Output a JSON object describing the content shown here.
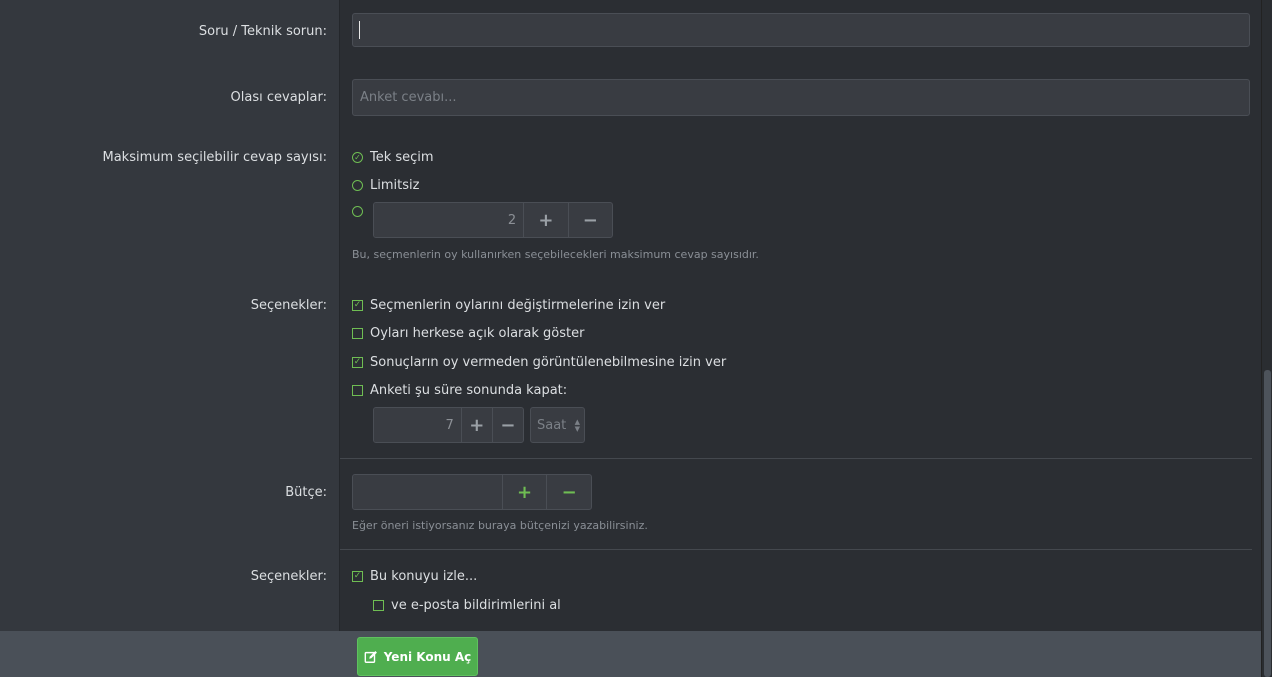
{
  "form": {
    "question_label": "Soru / Teknik sorun:",
    "question_value": "",
    "answers_label": "Olası cevaplar:",
    "answers_placeholder": "Anket cevabı...",
    "max_answers_label": "Maksimum seçilebilir cevap sayısı:",
    "max_answers_options": [
      {
        "label": "Tek seçim",
        "selected": true
      },
      {
        "label": "Limitsiz",
        "selected": false
      },
      {
        "label": "",
        "selected": false
      }
    ],
    "max_answers_value": "2",
    "max_answers_hint": "Bu, seçmenlerin oy kullanırken seçebilecekleri maksimum cevap sayısıdır.",
    "options_label": "Seçenekler:",
    "options": [
      {
        "label": "Seçmenlerin oylarını değiştirmelerine izin ver",
        "checked": true
      },
      {
        "label": "Oyları herkese açık olarak göster",
        "checked": false
      },
      {
        "label": "Sonuçların oy vermeden görüntülenebilmesine izin ver",
        "checked": true
      },
      {
        "label": "Anketi şu süre sonunda kapat:",
        "checked": false
      }
    ],
    "close_after_value": "7",
    "close_after_unit": "Saat",
    "budget_label": "Bütçe:",
    "budget_value": "",
    "budget_hint": "Eğer öneri istiyorsanız buraya bütçenizi yazabilirsiniz.",
    "watch_label": "Seçenekler:",
    "watch_options": [
      {
        "label": "Bu konuyu izle...",
        "checked": true
      },
      {
        "label": "ve e-posta bildirimlerini al",
        "checked": false
      }
    ],
    "submit_label": "Yeni Konu Aç"
  },
  "icons": {
    "plus": "+",
    "minus": "−",
    "check": "✓",
    "submit": "edit-icon"
  },
  "colors": {
    "accent": "#6fbd53",
    "submit_bg": "#4fae4f"
  }
}
